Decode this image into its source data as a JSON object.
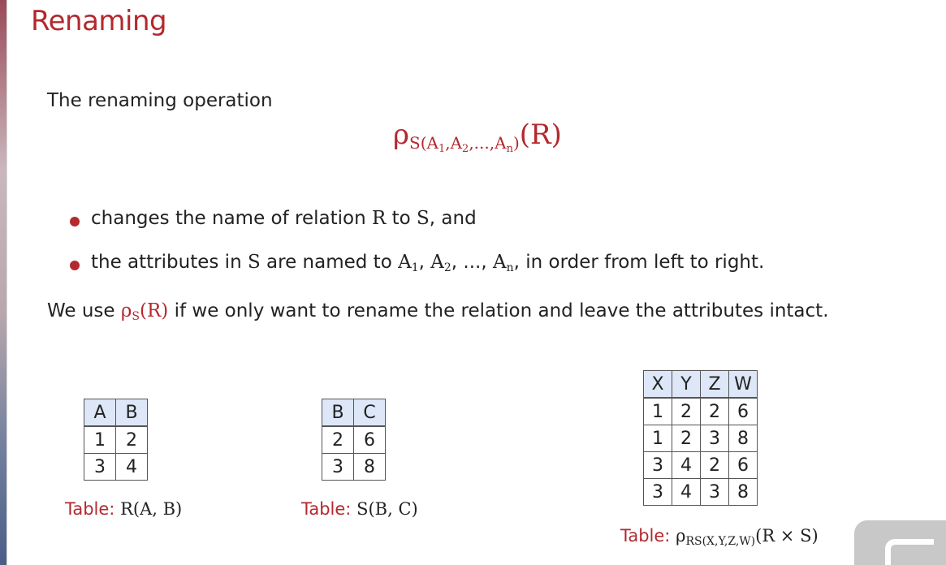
{
  "title": "Renaming",
  "intro": "The renaming operation",
  "formula": {
    "rho": "ρ",
    "subscript": "S(A",
    "sub_a1": "1",
    "sep1": ",A",
    "sub_a2": "2",
    "sep2": ",...,A",
    "sub_an": "n",
    "close": ")",
    "arg": "(R)"
  },
  "bullets": [
    {
      "pre": "changes the name of relation ",
      "R": "R",
      "mid": " to ",
      "S": "S",
      "post": ", and"
    },
    {
      "pre": "the attributes in ",
      "S": "S",
      "mid": " are named to ",
      "A1": "A",
      "A1_sub": "1",
      "c1": ", ",
      "A2": "A",
      "A2_sub": "2",
      "c2": ", ..., ",
      "An": "A",
      "An_sub": "n",
      "post": ", in order from left to right."
    }
  ],
  "note": {
    "pre": "We use ",
    "rho": "ρ",
    "rho_sub": "S",
    "arg": "(R)",
    "post": " if we only want to rename the relation and leave the attributes intact."
  },
  "table_R": {
    "headers": [
      "A",
      "B"
    ],
    "rows": [
      [
        "1",
        "2"
      ],
      [
        "3",
        "4"
      ]
    ],
    "caption_label": "Table:",
    "caption_text": "R(A, B)"
  },
  "table_S": {
    "headers": [
      "B",
      "C"
    ],
    "rows": [
      [
        "2",
        "6"
      ],
      [
        "3",
        "8"
      ]
    ],
    "caption_label": "Table:",
    "caption_text": "S(B, C)"
  },
  "table_RS": {
    "headers": [
      "X",
      "Y",
      "Z",
      "W"
    ],
    "rows": [
      [
        "1",
        "2",
        "2",
        "6"
      ],
      [
        "1",
        "2",
        "3",
        "8"
      ],
      [
        "3",
        "4",
        "2",
        "6"
      ],
      [
        "3",
        "4",
        "3",
        "8"
      ]
    ],
    "caption_label": "Table:",
    "caption_rho": "ρ",
    "caption_sub": "RS(X,Y,Z,W)",
    "caption_arg": "(R × S)"
  }
}
